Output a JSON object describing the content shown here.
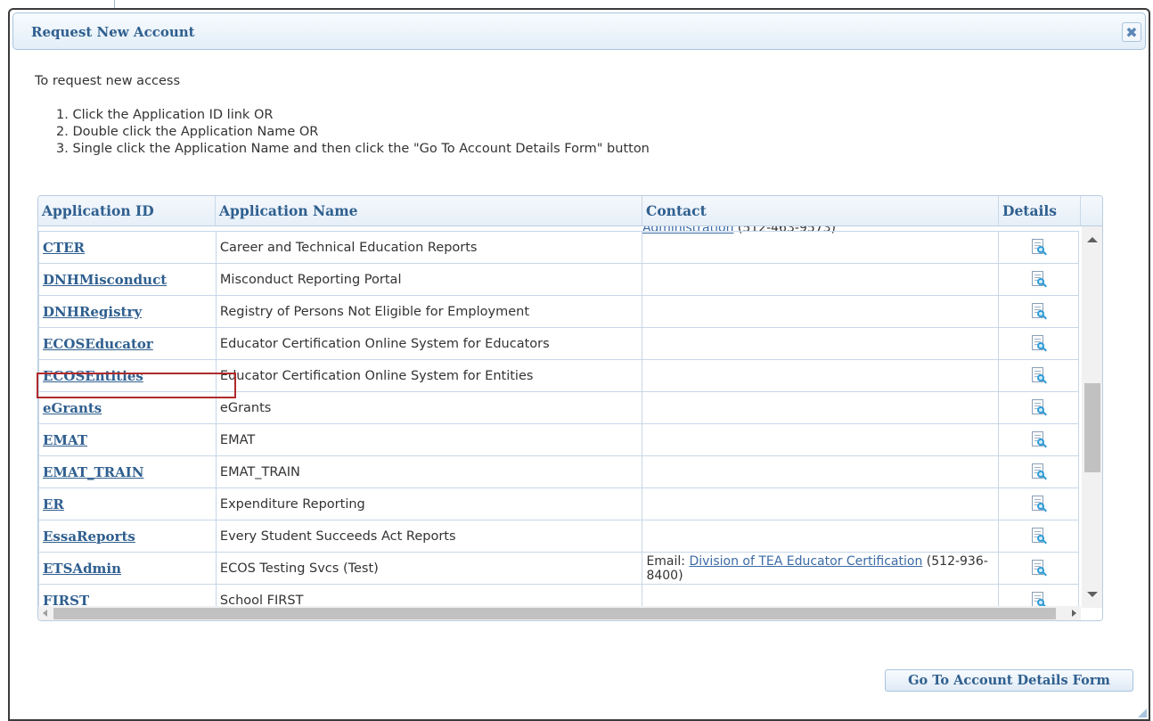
{
  "dialog": {
    "title": "Request New Account",
    "close_glyph": "✖",
    "intro": "To request new access",
    "steps": [
      "1. Click the Application ID link OR",
      "2. Double click the Application Name OR",
      "3. Single click the Application Name and then click the \"Go To Account Details Form\" button"
    ]
  },
  "grid": {
    "headers": [
      "Application ID",
      "Application Name",
      "Contact",
      "Details"
    ],
    "partial_contact": {
      "link": "Administration",
      "phone": "(512-463-9573)"
    },
    "rows": [
      {
        "id": "CTER",
        "name": "Career and Technical Education Reports",
        "contact_prefix": "",
        "contact_link": "",
        "contact_suffix": ""
      },
      {
        "id": "DNHMisconduct",
        "name": "Misconduct Reporting Portal",
        "contact_prefix": "",
        "contact_link": "",
        "contact_suffix": ""
      },
      {
        "id": "DNHRegistry",
        "name": "Registry of Persons Not Eligible for Employment",
        "contact_prefix": "",
        "contact_link": "",
        "contact_suffix": ""
      },
      {
        "id": "ECOSEducator",
        "name": "Educator Certification Online System for Educators",
        "contact_prefix": "",
        "contact_link": "",
        "contact_suffix": ""
      },
      {
        "id": "ECOSEntities",
        "name": "Educator Certification Online System for Entities",
        "contact_prefix": "",
        "contact_link": "",
        "contact_suffix": ""
      },
      {
        "id": "eGrants",
        "name": "eGrants",
        "contact_prefix": "",
        "contact_link": "",
        "contact_suffix": ""
      },
      {
        "id": "EMAT",
        "name": "EMAT",
        "contact_prefix": "",
        "contact_link": "",
        "contact_suffix": ""
      },
      {
        "id": "EMAT_TRAIN",
        "name": "EMAT_TRAIN",
        "contact_prefix": "",
        "contact_link": "",
        "contact_suffix": ""
      },
      {
        "id": "ER",
        "name": "Expenditure Reporting",
        "contact_prefix": "",
        "contact_link": "",
        "contact_suffix": ""
      },
      {
        "id": "EssaReports",
        "name": "Every Student Succeeds Act Reports",
        "contact_prefix": "",
        "contact_link": "",
        "contact_suffix": ""
      },
      {
        "id": "ETSAdmin",
        "name": "ECOS Testing Svcs (Test)",
        "contact_prefix": "Email: ",
        "contact_link": "Division of TEA Educator Certification",
        "contact_suffix": " (512-936-8400)"
      },
      {
        "id": "FIRST",
        "name": "School FIRST",
        "contact_prefix": "",
        "contact_link": "",
        "contact_suffix": ""
      }
    ],
    "highlighted_row_id": "ECOSEntities"
  },
  "buttons": {
    "go_to_form": "Go To Account Details Form"
  },
  "icons": {
    "details": "document-search-icon",
    "close": "close-icon"
  },
  "colors": {
    "header_text": "#2f5f8f",
    "link": "#3a6aa6",
    "highlight_border": "#b02b2b"
  }
}
